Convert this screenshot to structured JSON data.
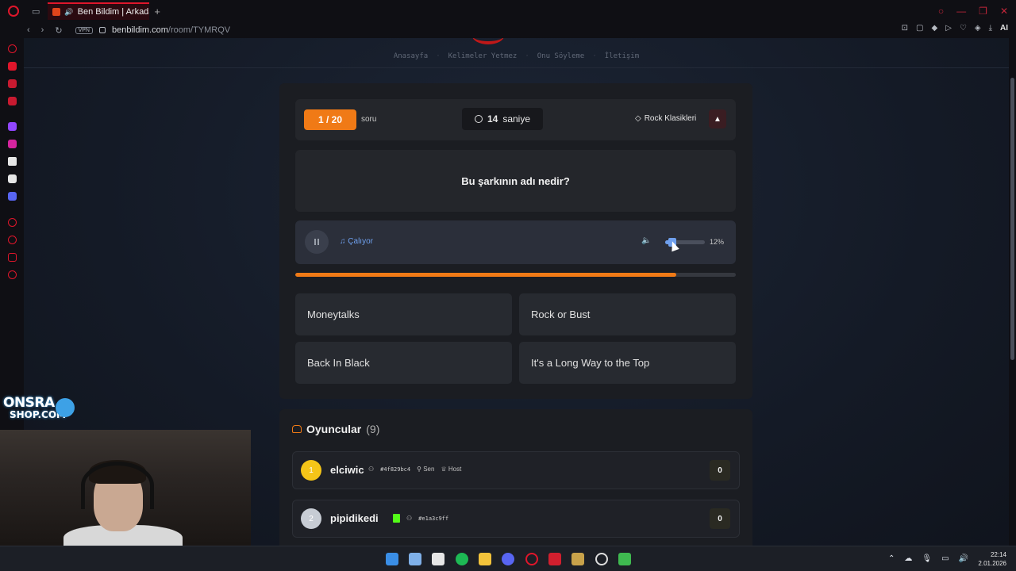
{
  "browser": {
    "tab_title": "Ben Bildim | Arkadaşla",
    "url_host": "benbildim.com",
    "url_path": "/room/TYMRQV",
    "vpn_label": "VPN",
    "ai_label": "AI",
    "accent_color": "#e0162b"
  },
  "site_nav": {
    "items": [
      "Anasayfa",
      "Kelimeler Yetmez",
      "Onu Söyleme",
      "İletişim"
    ]
  },
  "game": {
    "question_counter": "1 / 20",
    "question_counter_label": "soru",
    "timer_value": "14",
    "timer_unit": "saniye",
    "category": "Rock Klasikleri",
    "question": "Bu şarkının adı nedir?",
    "player_status": "Çalıyor",
    "volume_percent_label": "12%",
    "volume_level": 0.12,
    "time_progress": 0.865,
    "answers": [
      "Moneytalks",
      "Rock or Bust",
      "Back In Black",
      "It's a Long Way to the Top"
    ]
  },
  "players": {
    "title": "Oyuncular",
    "count": "(9)",
    "list": [
      {
        "rank": "1",
        "name": "elciwic",
        "id": "#4f829bc4",
        "tag1": "Sen",
        "tag2": "Host",
        "score": "0"
      },
      {
        "rank": "2",
        "name": "pipidikedi",
        "id": "#e1a3c9ff",
        "score": "0"
      }
    ]
  },
  "overlay": {
    "brand_line1": "ONSRA",
    "brand_line2": "SHOP.COM"
  },
  "taskbar": {
    "time": "22:14",
    "date": "2.01.2026"
  },
  "colors": {
    "orange": "#f07a16",
    "blue_accent": "#6fa0ee",
    "gold": "#f5c518",
    "silver": "#c7ccd4"
  }
}
